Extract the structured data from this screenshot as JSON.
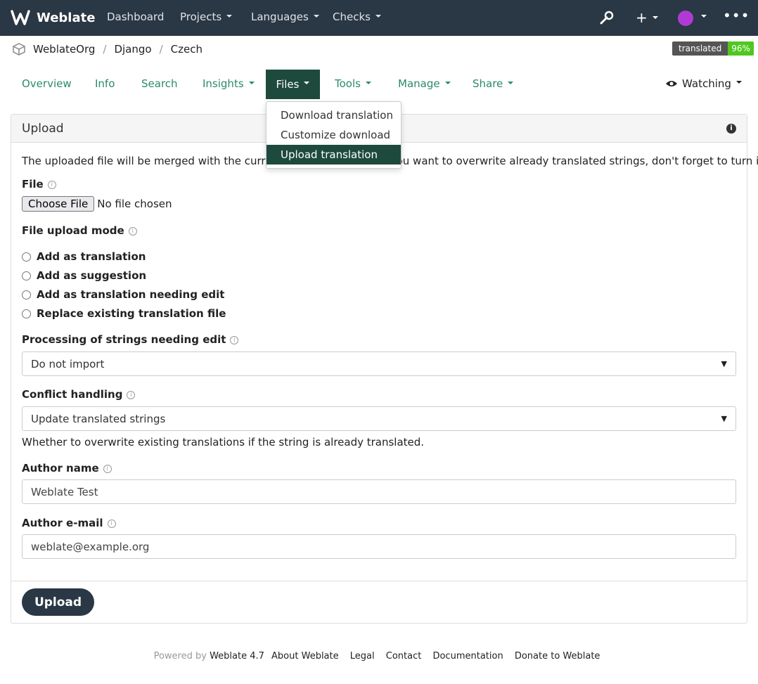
{
  "navbar": {
    "brand": "Weblate",
    "items": [
      "Dashboard",
      "Projects",
      "Languages",
      "Checks"
    ],
    "icons": [
      "wrench-icon",
      "plus-icon",
      "avatar",
      "more-icon"
    ]
  },
  "breadcrumb": {
    "items": [
      "WeblateOrg",
      "Django",
      "Czech"
    ]
  },
  "badge": {
    "label": "translated",
    "value": "96%"
  },
  "tabs": {
    "items": [
      "Overview",
      "Info",
      "Search",
      "Insights",
      "Files",
      "Tools",
      "Manage",
      "Share"
    ],
    "active": "Files",
    "watching": "Watching"
  },
  "files_menu": {
    "items": [
      "Download translation",
      "Customize download",
      "Upload translation"
    ],
    "active": "Upload translation"
  },
  "panel": {
    "title": "Upload",
    "intro": "The uploaded file will be merged with the current translation. In case you want to overwrite already translated strings, don't forget to turn it on.",
    "file_label": "File",
    "choose_file": "Choose File",
    "no_file": "No file chosen",
    "mode_label": "File upload mode",
    "modes": [
      "Add as translation",
      "Add as suggestion",
      "Add as translation needing edit",
      "Replace existing translation file"
    ],
    "fuzzy_label": "Processing of strings needing edit",
    "fuzzy_value": "Do not import",
    "conflict_label": "Conflict handling",
    "conflict_value": "Update translated strings",
    "conflict_help": "Whether to overwrite existing translations if the string is already translated.",
    "author_name_label": "Author name",
    "author_name_value": "Weblate Test",
    "author_email_label": "Author e-mail",
    "author_email_value": "weblate@example.org",
    "submit": "Upload"
  },
  "footer": {
    "powered_by": "Powered by",
    "version": "Weblate 4.7",
    "links": [
      "About Weblate",
      "Legal",
      "Contact",
      "Documentation",
      "Donate to Weblate"
    ]
  },
  "colors": {
    "navbar": "#2a3744",
    "accent": "#2a8a6d",
    "active_tab": "#1e4a3e",
    "badge_value": "#4fc71f"
  }
}
